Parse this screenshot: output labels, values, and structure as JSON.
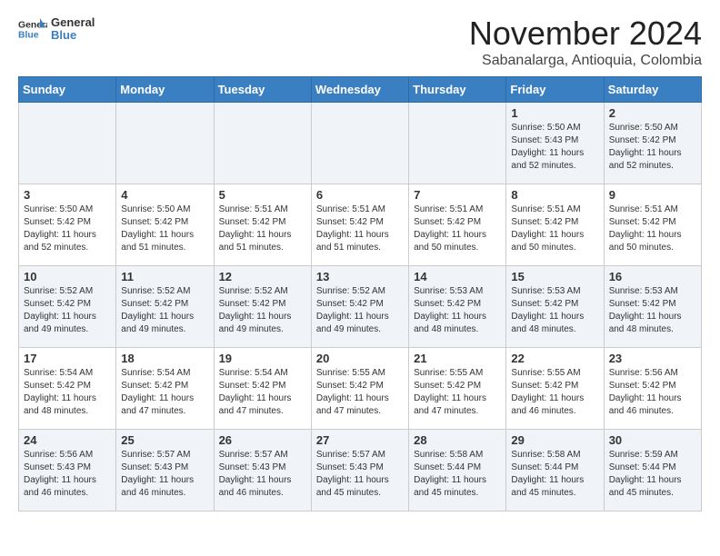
{
  "header": {
    "logo_general": "General",
    "logo_blue": "Blue",
    "month_title": "November 2024",
    "subtitle": "Sabanalarga, Antioquia, Colombia"
  },
  "weekdays": [
    "Sunday",
    "Monday",
    "Tuesday",
    "Wednesday",
    "Thursday",
    "Friday",
    "Saturday"
  ],
  "weeks": [
    [
      {
        "day": "",
        "sunrise": "",
        "sunset": "",
        "daylight": ""
      },
      {
        "day": "",
        "sunrise": "",
        "sunset": "",
        "daylight": ""
      },
      {
        "day": "",
        "sunrise": "",
        "sunset": "",
        "daylight": ""
      },
      {
        "day": "",
        "sunrise": "",
        "sunset": "",
        "daylight": ""
      },
      {
        "day": "",
        "sunrise": "",
        "sunset": "",
        "daylight": ""
      },
      {
        "day": "1",
        "sunrise": "5:50 AM",
        "sunset": "5:43 PM",
        "daylight": "11 hours and 52 minutes."
      },
      {
        "day": "2",
        "sunrise": "5:50 AM",
        "sunset": "5:42 PM",
        "daylight": "11 hours and 52 minutes."
      }
    ],
    [
      {
        "day": "3",
        "sunrise": "5:50 AM",
        "sunset": "5:42 PM",
        "daylight": "11 hours and 52 minutes."
      },
      {
        "day": "4",
        "sunrise": "5:50 AM",
        "sunset": "5:42 PM",
        "daylight": "11 hours and 51 minutes."
      },
      {
        "day": "5",
        "sunrise": "5:51 AM",
        "sunset": "5:42 PM",
        "daylight": "11 hours and 51 minutes."
      },
      {
        "day": "6",
        "sunrise": "5:51 AM",
        "sunset": "5:42 PM",
        "daylight": "11 hours and 51 minutes."
      },
      {
        "day": "7",
        "sunrise": "5:51 AM",
        "sunset": "5:42 PM",
        "daylight": "11 hours and 50 minutes."
      },
      {
        "day": "8",
        "sunrise": "5:51 AM",
        "sunset": "5:42 PM",
        "daylight": "11 hours and 50 minutes."
      },
      {
        "day": "9",
        "sunrise": "5:51 AM",
        "sunset": "5:42 PM",
        "daylight": "11 hours and 50 minutes."
      }
    ],
    [
      {
        "day": "10",
        "sunrise": "5:52 AM",
        "sunset": "5:42 PM",
        "daylight": "11 hours and 49 minutes."
      },
      {
        "day": "11",
        "sunrise": "5:52 AM",
        "sunset": "5:42 PM",
        "daylight": "11 hours and 49 minutes."
      },
      {
        "day": "12",
        "sunrise": "5:52 AM",
        "sunset": "5:42 PM",
        "daylight": "11 hours and 49 minutes."
      },
      {
        "day": "13",
        "sunrise": "5:52 AM",
        "sunset": "5:42 PM",
        "daylight": "11 hours and 49 minutes."
      },
      {
        "day": "14",
        "sunrise": "5:53 AM",
        "sunset": "5:42 PM",
        "daylight": "11 hours and 48 minutes."
      },
      {
        "day": "15",
        "sunrise": "5:53 AM",
        "sunset": "5:42 PM",
        "daylight": "11 hours and 48 minutes."
      },
      {
        "day": "16",
        "sunrise": "5:53 AM",
        "sunset": "5:42 PM",
        "daylight": "11 hours and 48 minutes."
      }
    ],
    [
      {
        "day": "17",
        "sunrise": "5:54 AM",
        "sunset": "5:42 PM",
        "daylight": "11 hours and 48 minutes."
      },
      {
        "day": "18",
        "sunrise": "5:54 AM",
        "sunset": "5:42 PM",
        "daylight": "11 hours and 47 minutes."
      },
      {
        "day": "19",
        "sunrise": "5:54 AM",
        "sunset": "5:42 PM",
        "daylight": "11 hours and 47 minutes."
      },
      {
        "day": "20",
        "sunrise": "5:55 AM",
        "sunset": "5:42 PM",
        "daylight": "11 hours and 47 minutes."
      },
      {
        "day": "21",
        "sunrise": "5:55 AM",
        "sunset": "5:42 PM",
        "daylight": "11 hours and 47 minutes."
      },
      {
        "day": "22",
        "sunrise": "5:55 AM",
        "sunset": "5:42 PM",
        "daylight": "11 hours and 46 minutes."
      },
      {
        "day": "23",
        "sunrise": "5:56 AM",
        "sunset": "5:42 PM",
        "daylight": "11 hours and 46 minutes."
      }
    ],
    [
      {
        "day": "24",
        "sunrise": "5:56 AM",
        "sunset": "5:43 PM",
        "daylight": "11 hours and 46 minutes."
      },
      {
        "day": "25",
        "sunrise": "5:57 AM",
        "sunset": "5:43 PM",
        "daylight": "11 hours and 46 minutes."
      },
      {
        "day": "26",
        "sunrise": "5:57 AM",
        "sunset": "5:43 PM",
        "daylight": "11 hours and 46 minutes."
      },
      {
        "day": "27",
        "sunrise": "5:57 AM",
        "sunset": "5:43 PM",
        "daylight": "11 hours and 45 minutes."
      },
      {
        "day": "28",
        "sunrise": "5:58 AM",
        "sunset": "5:44 PM",
        "daylight": "11 hours and 45 minutes."
      },
      {
        "day": "29",
        "sunrise": "5:58 AM",
        "sunset": "5:44 PM",
        "daylight": "11 hours and 45 minutes."
      },
      {
        "day": "30",
        "sunrise": "5:59 AM",
        "sunset": "5:44 PM",
        "daylight": "11 hours and 45 minutes."
      }
    ]
  ]
}
